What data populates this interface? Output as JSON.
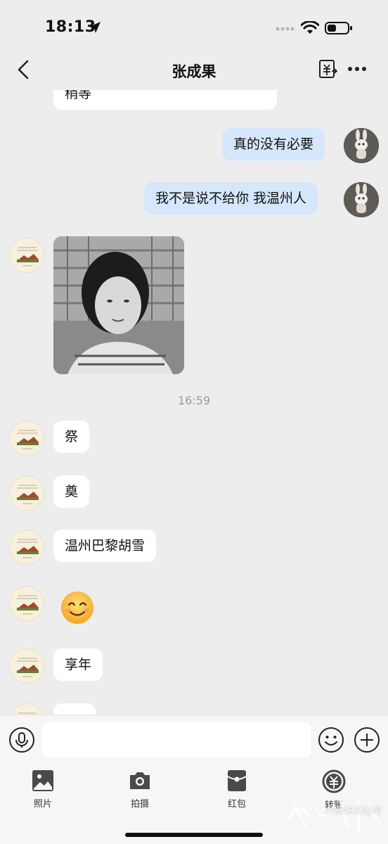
{
  "status_bar": {
    "time": "18:13"
  },
  "nav": {
    "title": "张成果"
  },
  "messages": [
    {
      "text": "稍等"
    },
    {
      "text": "真的没有必要"
    },
    {
      "text": "我不是说不给你 我温州人"
    },
    {
      "text": "祭"
    },
    {
      "text": "奠"
    },
    {
      "text": "温州巴黎胡雪"
    },
    {
      "text": "享年"
    }
  ],
  "timestamp": "16:59",
  "emoji": "smiling-face",
  "actions": [
    {
      "label": "照片"
    },
    {
      "label": "拍摄"
    },
    {
      "label": "红包"
    },
    {
      "label": "转账"
    }
  ],
  "watermark": {
    "text": "HUARENJIE"
  },
  "colors": {
    "background": "#ededed",
    "outgoing_bubble": "#d6e6fb",
    "incoming_bubble": "#ffffff"
  }
}
